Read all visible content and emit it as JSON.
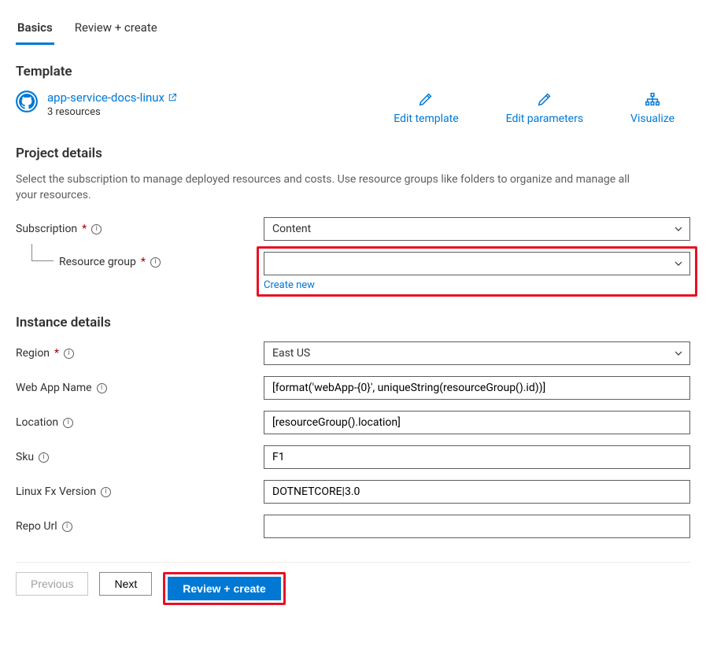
{
  "tabs": {
    "basics": "Basics",
    "review": "Review + create"
  },
  "template": {
    "title": "Template",
    "link_text": "app-service-docs-linux",
    "resources_text": "3 resources",
    "edit_template": "Edit template",
    "edit_parameters": "Edit parameters",
    "visualize": "Visualize"
  },
  "project": {
    "title": "Project details",
    "desc": "Select the subscription to manage deployed resources and costs. Use resource groups like folders to organize and manage all your resources.",
    "subscription_label": "Subscription",
    "subscription_value": "Content",
    "resource_group_label": "Resource group",
    "resource_group_value": "",
    "create_new": "Create new"
  },
  "instance": {
    "title": "Instance details",
    "region_label": "Region",
    "region_value": "East US",
    "web_app_name_label": "Web App Name",
    "web_app_name_value": "[format('webApp-{0}', uniqueString(resourceGroup().id))]",
    "location_label": "Location",
    "location_value": "[resourceGroup().location]",
    "sku_label": "Sku",
    "sku_value": "F1",
    "linux_fx_label": "Linux Fx Version",
    "linux_fx_value": "DOTNETCORE|3.0",
    "repo_url_label": "Repo Url",
    "repo_url_value": ""
  },
  "footer": {
    "previous": "Previous",
    "next": "Next",
    "review_create": "Review + create"
  }
}
